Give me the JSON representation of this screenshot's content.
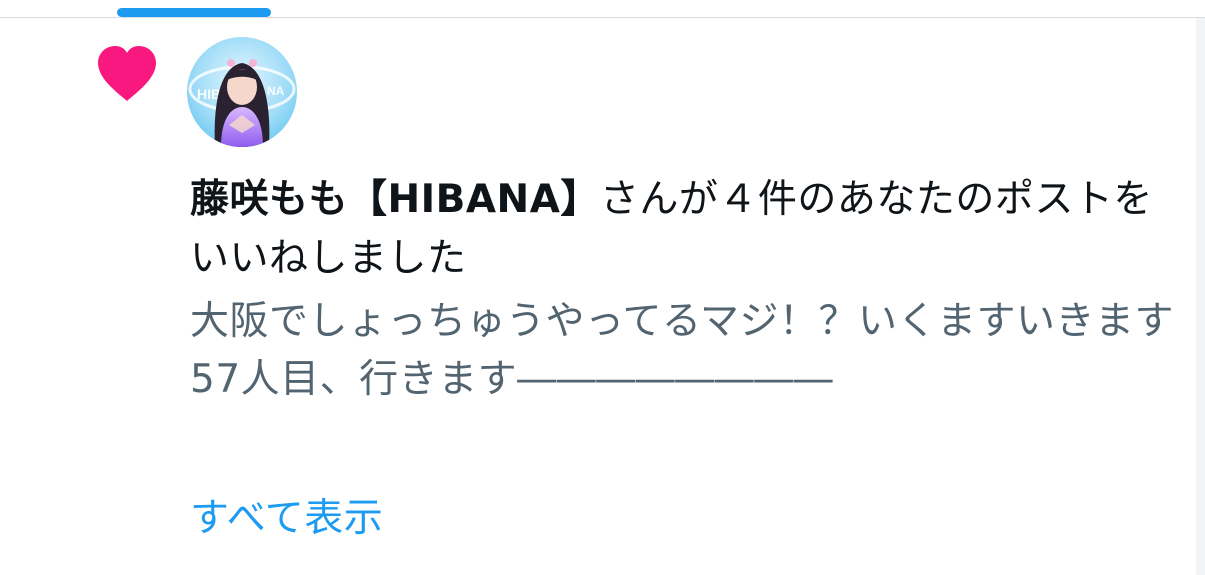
{
  "notification": {
    "type_icon": "heart-icon",
    "icon_color": "#f91880",
    "avatar": "user-avatar",
    "user_name": "藤咲もも【HIBANA】",
    "action_text": "さんが４件のあなたのポストをいいねしました",
    "post_lines": [
      "大阪でしょっちゅうやってるマジ！？いくますいきます",
      "57人目、行きます――――――――"
    ],
    "show_all_label": "すべて表示"
  },
  "colors": {
    "accent": "#1d9bf0",
    "like": "#f91880",
    "primary_text": "#0f1419",
    "secondary_text": "#536471"
  }
}
